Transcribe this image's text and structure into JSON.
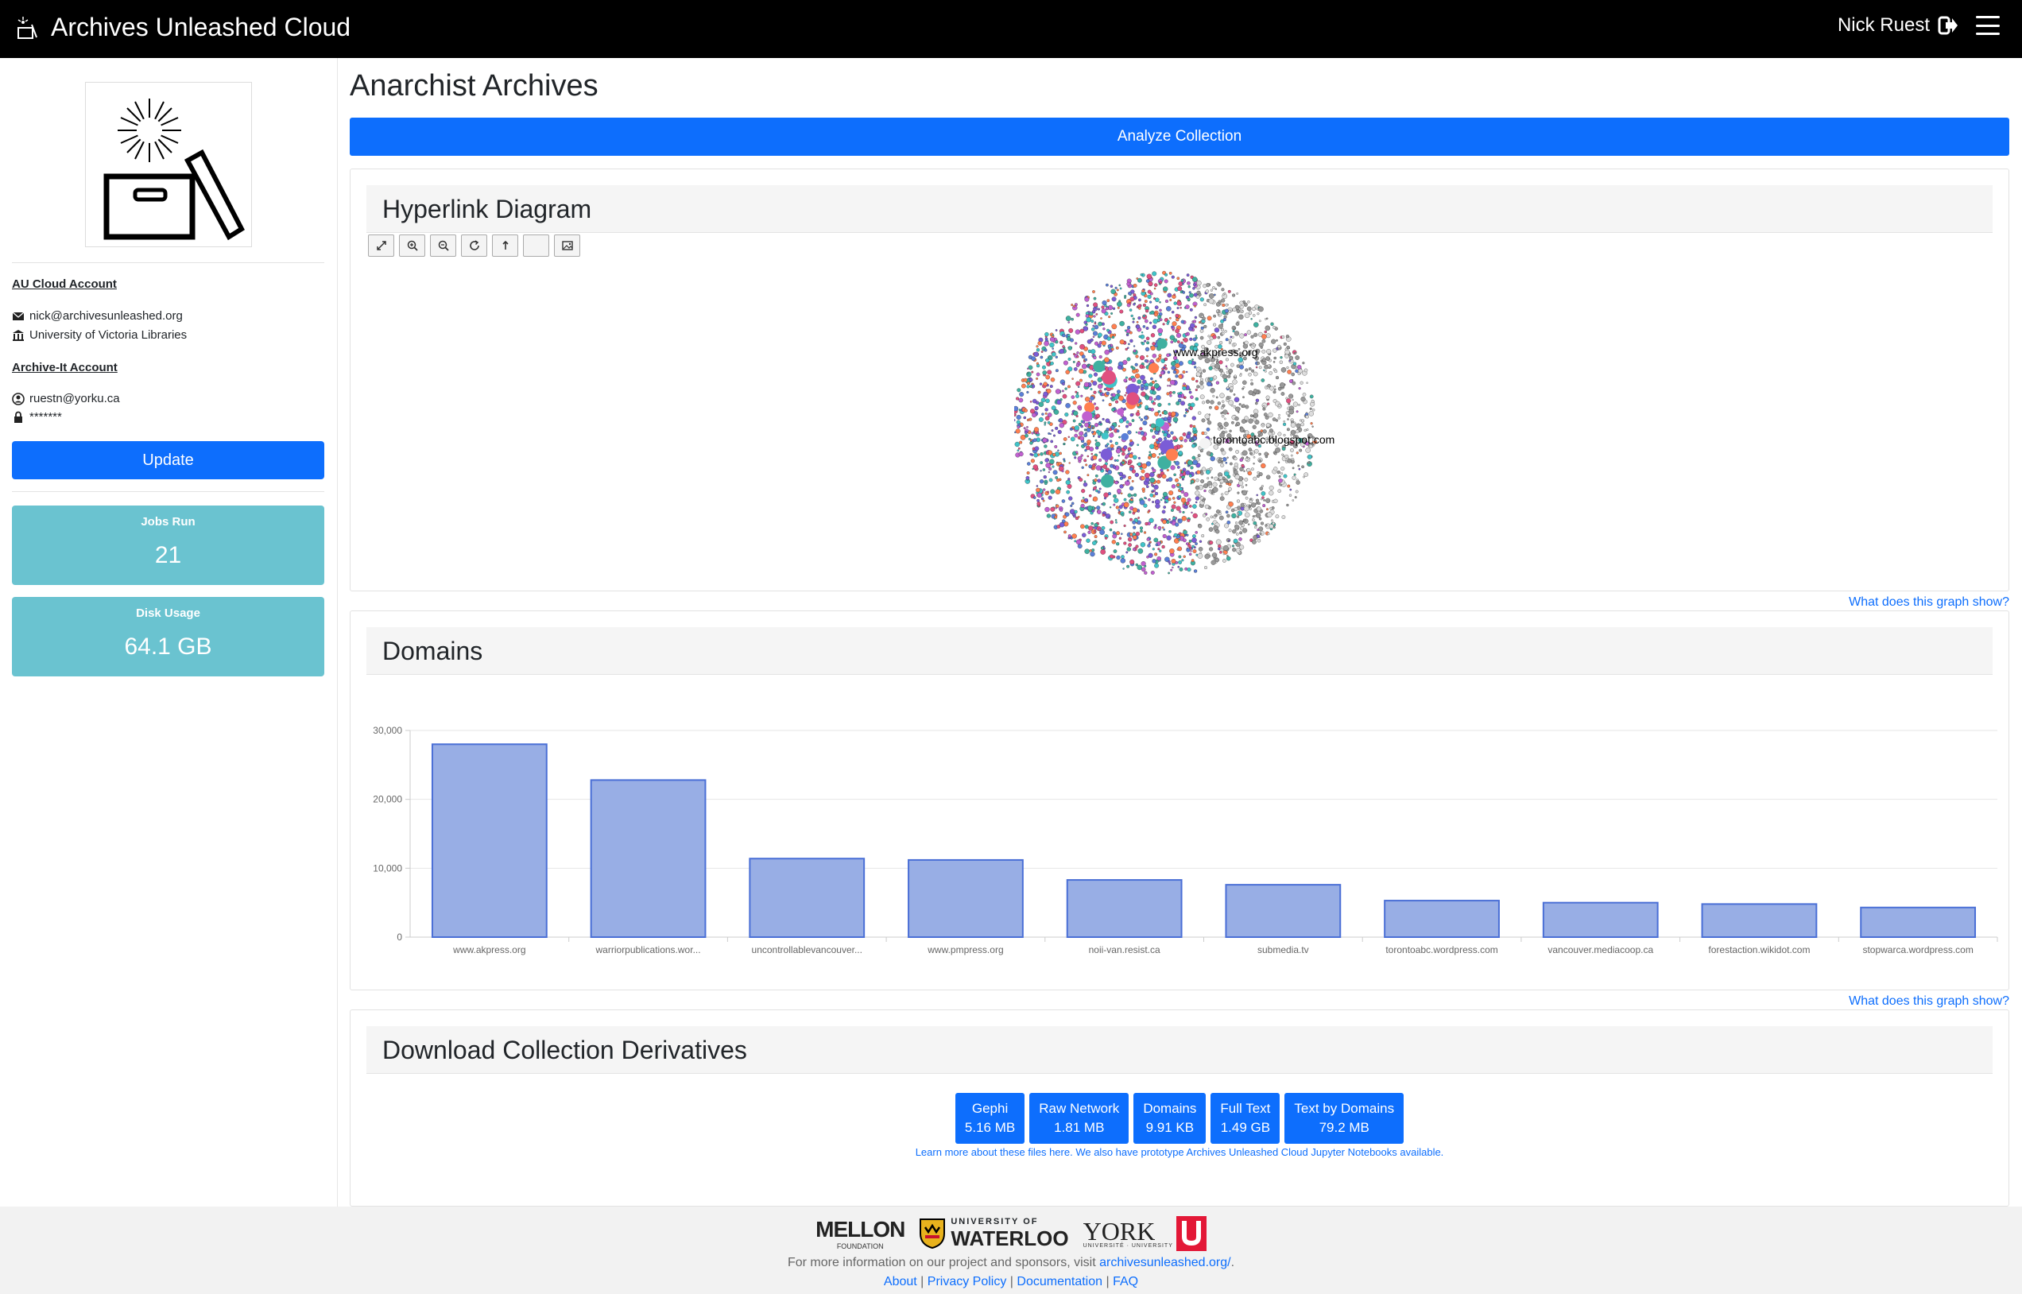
{
  "navbar": {
    "brand": "Archives Unleashed Cloud",
    "user": "Nick Ruest"
  },
  "sidebar": {
    "au_heading": "AU Cloud Account",
    "email": "nick@archivesunleashed.org",
    "institution": "University of Victoria Libraries",
    "ait_heading": "Archive-It Account",
    "ait_user": "ruestn@yorku.ca",
    "ait_password": "*******",
    "update_label": "Update",
    "stats": [
      {
        "label": "Jobs Run",
        "value": "21"
      },
      {
        "label": "Disk Usage",
        "value": "64.1 GB"
      }
    ]
  },
  "main": {
    "title": "Anarchist Archives",
    "analyze_label": "Analyze Collection",
    "hyperlink": {
      "title": "Hyperlink Diagram",
      "node_labels": [
        "www.akpress.org",
        "torontoabc.blogspot.com"
      ],
      "help": "What does this graph show?"
    },
    "domains": {
      "title": "Domains",
      "help": "What does this graph show?"
    },
    "derivatives": {
      "title": "Download Collection Derivatives",
      "buttons": [
        {
          "name": "Gephi",
          "size": "5.16 MB"
        },
        {
          "name": "Raw Network",
          "size": "1.81 MB"
        },
        {
          "name": "Domains",
          "size": "9.91 KB"
        },
        {
          "name": "Full Text",
          "size": "1.49 GB"
        },
        {
          "name": "Text by Domains",
          "size": "79.2 MB"
        }
      ],
      "note": "Learn more about these files here. We also have prototype Archives Unleashed Cloud Jupyter Notebooks available."
    }
  },
  "chart_data": {
    "type": "bar",
    "categories": [
      "www.akpress.org",
      "warriorpublications.wor...",
      "uncontrollablevancouver...",
      "www.pmpress.org",
      "noii-van.resist.ca",
      "submedia.tv",
      "torontoabc.wordpress.com",
      "vancouver.mediacoop.ca",
      "forestaction.wikidot.com",
      "stopwarca.wordpress.com"
    ],
    "values": [
      28000,
      22800,
      11400,
      11200,
      8300,
      7600,
      5300,
      5000,
      4800,
      4300
    ],
    "ylim": [
      0,
      30000
    ],
    "yticks": [
      "0",
      "10,000",
      "20,000",
      "30,000"
    ],
    "ytick_values": [
      0,
      10000,
      20000,
      30000
    ],
    "bar_fill": "#98aee5",
    "bar_stroke": "#4a6fd6",
    "grid": true
  },
  "footer": {
    "sponsor_1": "MELLON",
    "sponsor_1_sub": "FOUNDATION",
    "sponsor_2_top": "UNIVERSITY OF",
    "sponsor_2": "WATERLOO",
    "sponsor_3": "YORK",
    "sponsor_3_sub": "UNIVERSITÉ · UNIVERSITY",
    "info_prefix": "For more information on our project and sponsors, visit",
    "info_link": "archivesunleashed.org/",
    "info_suffix": ".",
    "links": [
      "About",
      "Privacy Policy",
      "Documentation",
      "FAQ"
    ]
  }
}
